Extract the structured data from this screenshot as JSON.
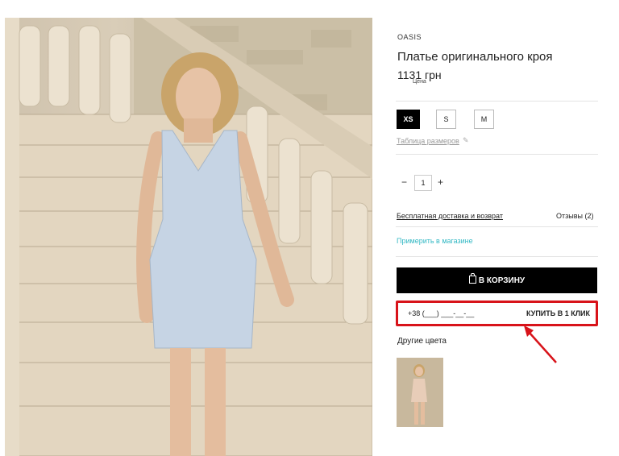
{
  "product": {
    "brand": "OASIS",
    "title": "Платье оригинального кроя",
    "price": "1131 грн",
    "price_label": "Цена"
  },
  "sizes": [
    {
      "label": "XS",
      "selected": true
    },
    {
      "label": "S",
      "selected": false
    },
    {
      "label": "M",
      "selected": false
    }
  ],
  "size_table_link": "Таблица размеров",
  "quantity": {
    "minus": "−",
    "value": "1",
    "plus": "+"
  },
  "delivery_link": "Бесплатная доставка и возврат",
  "reviews": "Отзывы (2)",
  "try_in_store": "Примерить в магазине",
  "cart_button": "В КОРЗИНУ",
  "one_click": {
    "phone_placeholder": "+38 (___) ___-__-__",
    "button": "КУПИТЬ В 1 КЛИК",
    "highlight_color": "#d8131a"
  },
  "other_colors_label": "Другие цвета",
  "colors": {
    "accent": "#33b8c4",
    "button_bg": "#000000"
  }
}
